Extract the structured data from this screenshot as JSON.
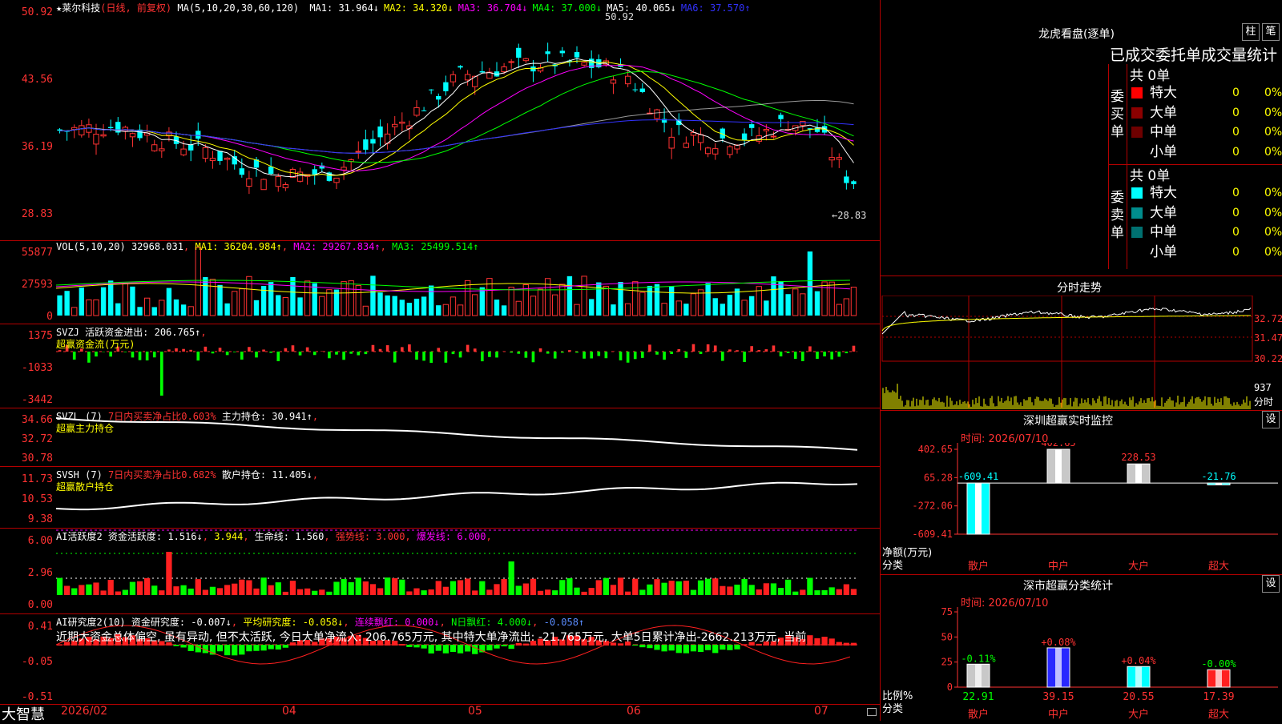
{
  "chart": {
    "stock_name": "★莱尔科技",
    "period": "(日线, 前复权)",
    "ma_label": "MA(5,10,20,30,60,120)",
    "ma_values": [
      {
        "label": "MA1:",
        "value": "31.964",
        "arrow": "↓",
        "color": "#ffffff"
      },
      {
        "label": "MA2:",
        "value": "34.320",
        "arrow": "↓",
        "color": "#ffff00"
      },
      {
        "label": "MA3:",
        "value": "36.704",
        "arrow": "↓",
        "color": "#ff00ff"
      },
      {
        "label": "MA4:",
        "value": "37.000",
        "arrow": "↓",
        "color": "#00ff00"
      },
      {
        "label": "MA5:",
        "value": "40.065",
        "arrow": "↓",
        "color": "#ffffff"
      },
      {
        "label": "MA6:",
        "value": "37.570",
        "arrow": "↑",
        "color": "#3232ff"
      }
    ],
    "price_ticks": [
      "50.92",
      "43.56",
      "36.19",
      "28.83"
    ],
    "high_label": "50.92",
    "low_label": "←28.83",
    "high_value": 50.92,
    "low_value": 28.83,
    "date_labels": [
      "2026/02",
      "04",
      "05",
      "06",
      "07"
    ]
  },
  "vol": {
    "header": "VOL(5,10,20)",
    "value": "32968.031",
    "ma1": "MA1: 36204.984↑",
    "ma2": "MA2: 29267.834↑",
    "ma3": "MA3: 25499.514↑",
    "ticks": [
      "55877",
      "27593",
      "0"
    ]
  },
  "svzj": {
    "header": "SVZJ",
    "label": "活跃资金进出: 206.765↑",
    "sub": "超赢资金流(万元)",
    "ticks": [
      "1375",
      "-1033",
      "-3442"
    ]
  },
  "svzl": {
    "header": "SVZL (7)",
    "label1": "7日内买卖净占比0.603%",
    "label2": "主力持仓: 30.941↑",
    "sub": "超赢主力持仓",
    "ticks": [
      "34.66",
      "32.72",
      "30.78"
    ]
  },
  "svsh": {
    "header": "SVSH (7)",
    "label1": "7日内买卖净占比0.682%",
    "label2": "散户持仓: 11.405↓",
    "sub": "超赢散户持仓",
    "ticks": [
      "11.73",
      "10.53",
      "9.38"
    ]
  },
  "ai1": {
    "header": "AI活跃度2",
    "label": "资金活跃度: 1.516↓",
    "v2": "3.944",
    "life": "生命线: 1.560",
    "strong": "强势线: 3.000",
    "burst": "爆发线: 6.000",
    "ticks": [
      "6.00",
      "2.96",
      "0.00"
    ]
  },
  "ai2": {
    "header": "AI研究度2(10)",
    "label": "资金研究度: -0.007↓",
    "avg": "平均研究度: -0.058↓",
    "cont": "连续飘红: 0.000↓",
    "nday": "N日飘红: 4.000↓",
    "last": "-0.058↑",
    "comment": "近期大资金总体偏空, 虽有异动, 但不太活跃, 今日大单净流入: 206.765万元, 其中特大单净流出: -21.765万元, 大单5日累计净出-2662.213万元, 当前",
    "ticks": [
      "0.41",
      "-0.05",
      "-0.51"
    ]
  },
  "logo": "大智慧",
  "lhb": {
    "title": "龙虎看盘(逐单)",
    "btn1": "柱",
    "btn2": "笔",
    "header_text": "已成交委托单成交量统计",
    "buy": {
      "side": "委买单",
      "total": "共 0单",
      "rows": [
        {
          "label": "特大",
          "v1": "0",
          "v2": "0%",
          "color": "#ff0000"
        },
        {
          "label": "大单",
          "v1": "0",
          "v2": "0%",
          "color": "#8c0000"
        },
        {
          "label": "中单",
          "v1": "0",
          "v2": "0%",
          "color": "#6e0000"
        },
        {
          "label": "小单",
          "v1": "0",
          "v2": "0%",
          "color": "#000000"
        }
      ]
    },
    "sell": {
      "side": "委卖单",
      "total": "共 0单",
      "rows": [
        {
          "label": "特大",
          "v1": "0",
          "v2": "0%",
          "color": "#00ffff"
        },
        {
          "label": "大单",
          "v1": "0",
          "v2": "0%",
          "color": "#008c8c"
        },
        {
          "label": "中单",
          "v1": "0",
          "v2": "0%",
          "color": "#007070"
        },
        {
          "label": "小单",
          "v1": "0",
          "v2": "0%",
          "color": "#000000"
        }
      ]
    }
  },
  "intraday": {
    "title": "分时走势",
    "ticks": [
      "32.72",
      "31.47",
      "30.22"
    ],
    "vol_tick": "937",
    "vol_label": "分时"
  },
  "monitor": {
    "title": "深圳超赢实时监控",
    "btn": "设",
    "time": "时间: 2026/07/10",
    "ticks": [
      "402.65",
      "65.28",
      "-272.06",
      "-609.41"
    ],
    "ylabel1": "净额(万元)",
    "ylabel2": "分类",
    "categories": [
      "散户",
      "中户",
      "大户",
      "超大"
    ],
    "values": [
      -609.41,
      402.65,
      228.53,
      -21.76
    ],
    "value_labels": [
      "-609.41",
      "402.65",
      "228.53",
      "-21.76"
    ]
  },
  "classify": {
    "title": "深市超赢分类统计",
    "btn": "设",
    "time": "时间: 2026/07/10",
    "ticks": [
      "75",
      "50",
      "25",
      "0"
    ],
    "ylabel1": "比例%",
    "ylabel2": "分类",
    "categories": [
      "散户",
      "中户",
      "大户",
      "超大"
    ],
    "values": [
      22.91,
      39.15,
      20.55,
      17.39
    ],
    "value_labels": [
      "22.91",
      "39.15",
      "20.55",
      "17.39"
    ],
    "changes": [
      "-0.11%",
      "+0.08%",
      "+0.04%",
      "-0.00%"
    ],
    "colors": [
      "#c8c8c8",
      "#2828ff",
      "#00ffff",
      "#ff2020"
    ]
  },
  "chart_data": [
    {
      "type": "bar",
      "title": "深圳超赢实时监控",
      "ylabel": "净额(万元)",
      "xlabel": "分类",
      "categories": [
        "散户",
        "中户",
        "大户",
        "超大"
      ],
      "values": [
        -609.41,
        402.65,
        228.53,
        -21.76
      ],
      "ylim": [
        -609.41,
        402.65
      ]
    },
    {
      "type": "bar",
      "title": "深市超赢分类统计",
      "ylabel": "比例%",
      "xlabel": "分类",
      "categories": [
        "散户",
        "中户",
        "大户",
        "超大"
      ],
      "values": [
        22.91,
        39.15,
        20.55,
        17.39
      ],
      "ylim": [
        0,
        75
      ]
    }
  ]
}
